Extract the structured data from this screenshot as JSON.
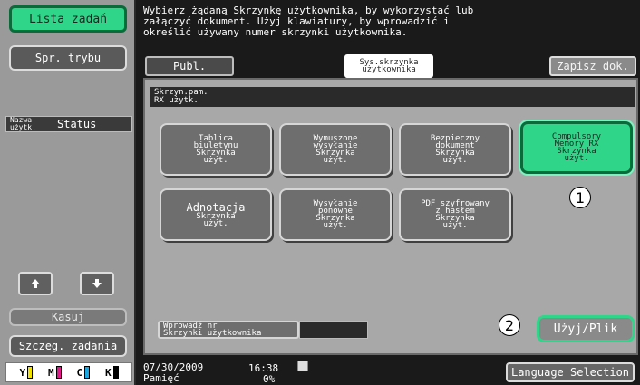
{
  "sidebar": {
    "job_list": "Lista zadań",
    "mode_check": "Spr. trybu",
    "header_name_top": "Nazwa",
    "header_name_bottom": "użytk.",
    "header_status": "Status",
    "up_icon": "arrow-up-icon",
    "down_icon": "arrow-down-icon",
    "delete": "Kasuj",
    "job_details": "Szczeg. zadania",
    "toner": [
      {
        "label": "Y",
        "color": "#f2e200"
      },
      {
        "label": "M",
        "color": "#e0188a"
      },
      {
        "label": "C",
        "color": "#1aa6e0"
      },
      {
        "label": "K",
        "color": "#000000"
      }
    ]
  },
  "message": "Wybierz żądaną Skrzynkę użytkownika, by wykorzystać lub\nzałączyć dokument. Użyj klawiatury, by wprowadzić i\nokreślić  używany numer skrzynki użytkownika.",
  "tabs": {
    "public": "Publ.",
    "system_box_line1": "Sys.skrzynka",
    "system_box_line2": "użytkownika",
    "save_document": "Zapisz dok."
  },
  "path": {
    "line1": "Skrzyn.pam.",
    "line2": "RX użytk."
  },
  "boxes": {
    "bulletin": [
      "Tablica",
      "biuletynu",
      "Skrzynka",
      "użyt."
    ],
    "forced_tx": [
      "Wymuszone",
      "wysyłanie",
      "Skrzynka",
      "użyt."
    ],
    "secure_doc": [
      "Bezpieczny",
      "dokument",
      "Skrzynka",
      "użyt."
    ],
    "compulsory_rx": [
      "Compulsory",
      "Memory RX",
      "Skrzynka",
      "użyt."
    ],
    "annotation": [
      "Adnotacja",
      "Skrzynka",
      "użyt."
    ],
    "retransmit": [
      "Wysyłanie",
      "ponowne",
      "Skrzynka",
      "użyt."
    ],
    "encrypted_pdf": [
      "PDF szyfrowany",
      "z hasłem",
      "Skrzynka",
      "użyt."
    ]
  },
  "box_number": {
    "label_line1": "Wprowadź nr",
    "label_line2": "Skrzynki użytkownika",
    "value": ""
  },
  "use_file": "Użyj/Plik",
  "callouts": [
    "1",
    "2"
  ],
  "status": {
    "date": "07/30/2009",
    "time": "16:38",
    "memory_label": "Pamięć",
    "memory_value": "0%",
    "network_icon": "network-icon",
    "language_selection": "Language Selection"
  }
}
